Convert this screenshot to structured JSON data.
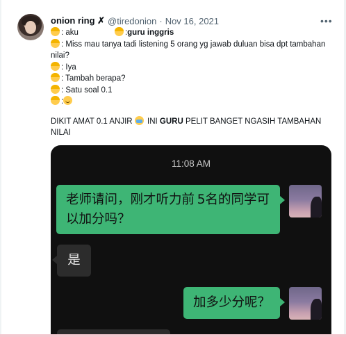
{
  "tweet": {
    "display_name": "onion ring ✗",
    "handle": "@tiredonion",
    "separator": "·",
    "date": "Nov 16, 2021",
    "more_label": "•••",
    "lines": {
      "l1_a": ": aku",
      "l1_b": ":",
      "l1_c": "guru inggris",
      "l2": ": Miss mau tanya tadi listening 5 orang yg jawab duluan bisa dpt tambahan nilai?",
      "l3": ": Iya",
      "l4": ": Tambah berapa?",
      "l5": ": Satu soal 0.1",
      "l6": ":",
      "l7_a": "DIKIT AMAT 0.1 ANJIR",
      "l7_b": "INI",
      "l7_c": "GURU",
      "l7_d": "PELIT BANGET NGASIH TAMBAHAN NILAI"
    }
  },
  "chat_screenshot": {
    "time": "11:08 AM",
    "messages": [
      {
        "side": "right",
        "text": "老师请问，刚才听力前 5名的同学可以加分吗？"
      },
      {
        "side": "left",
        "text": "是"
      },
      {
        "side": "right",
        "text": "加多少分呢？"
      }
    ]
  },
  "icons": [
    "avatar",
    "more-icon",
    "emoji-person",
    "emoji-smile",
    "emoji-crying"
  ]
}
